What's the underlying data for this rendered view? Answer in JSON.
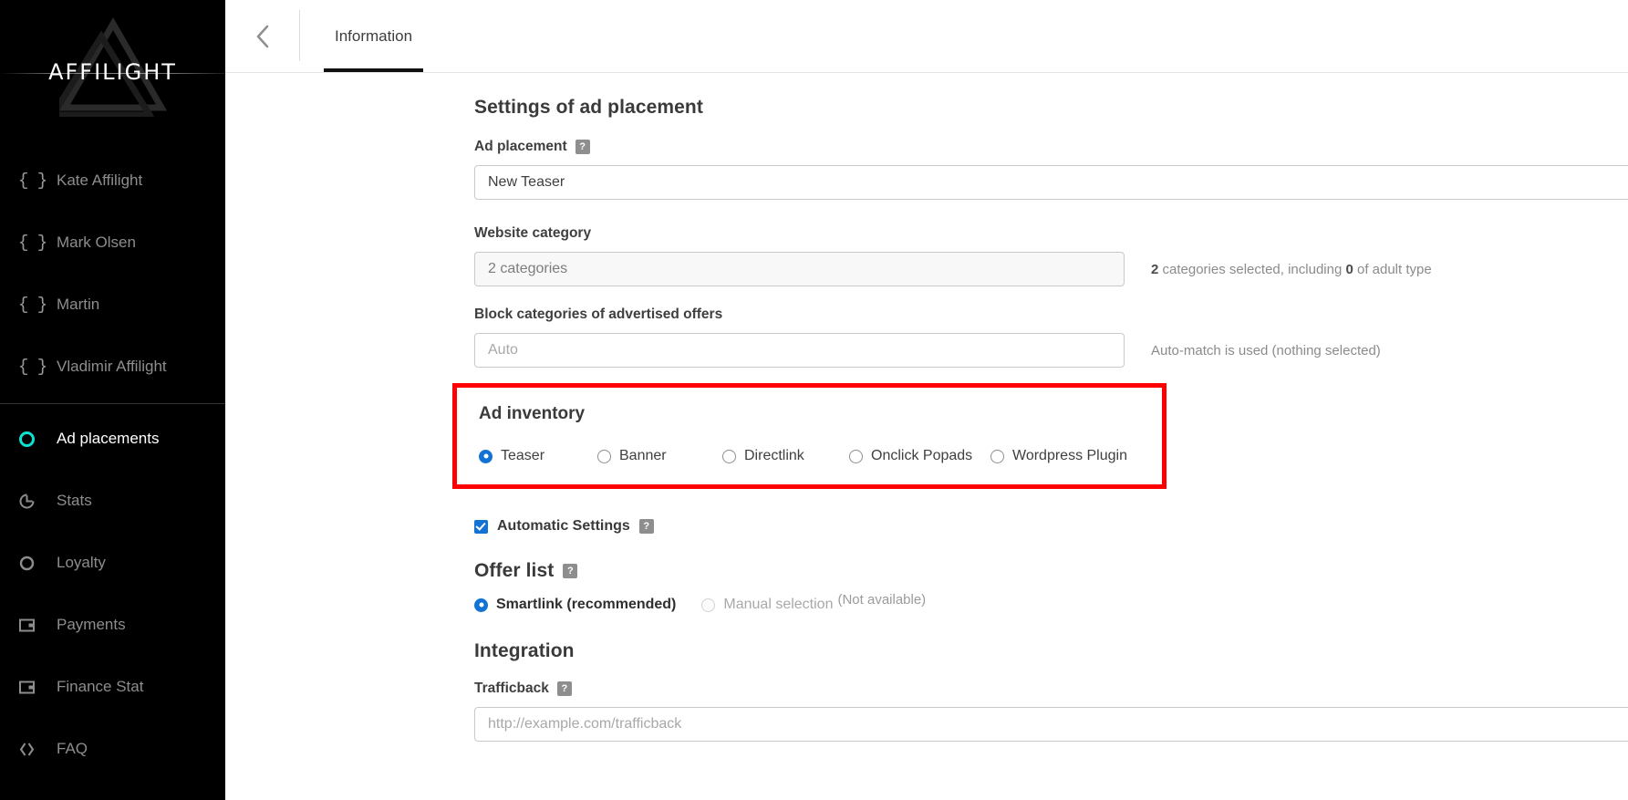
{
  "sidebar": {
    "logo": {
      "text": "AFFILIGHT",
      "icon": "triangle-logo-icon"
    },
    "accounts": [
      {
        "label": "Kate Affilight",
        "icon": "braces-icon"
      },
      {
        "label": "Mark Olsen",
        "icon": "braces-icon"
      },
      {
        "label": "Martin",
        "icon": "braces-icon"
      },
      {
        "label": "Vladimir Affilight",
        "icon": "braces-icon"
      }
    ],
    "nav": [
      {
        "label": "Ad placements",
        "icon": "ring-icon",
        "active": true
      },
      {
        "label": "Stats",
        "icon": "pie-chart-icon",
        "active": false
      },
      {
        "label": "Loyalty",
        "icon": "circle-icon",
        "active": false
      },
      {
        "label": "Payments",
        "icon": "wallet-icon",
        "active": false
      },
      {
        "label": "Finance Stat",
        "icon": "wallet-icon",
        "active": false
      },
      {
        "label": "FAQ",
        "icon": "diamond-brackets-icon",
        "active": false
      }
    ],
    "active_color": "#0ae3d2"
  },
  "topbar": {
    "back_icon": "chevron-left-icon",
    "tabs": [
      {
        "label": "Information",
        "active": true
      }
    ]
  },
  "main": {
    "section_settings_title": "Settings of ad placement",
    "ad_placement": {
      "label": "Ad placement",
      "help": "?",
      "value": "New Teaser"
    },
    "website_category": {
      "label": "Website category",
      "value": "2 categories",
      "hint_count": "2",
      "hint_mid": " categories selected, including ",
      "hint_adult_count": "0",
      "hint_end": " of adult type"
    },
    "block_categories": {
      "label": "Block categories of advertised offers",
      "placeholder": "Auto",
      "value": "",
      "hint": "Auto-match is used (nothing selected)"
    },
    "ad_inventory": {
      "title": "Ad inventory",
      "highlight_color": "#ff0000",
      "options": [
        {
          "label": "Teaser",
          "selected": true
        },
        {
          "label": "Banner",
          "selected": false
        },
        {
          "label": "Directlink",
          "selected": false
        },
        {
          "label": "Onclick Popads",
          "selected": false
        },
        {
          "label": "Wordpress Plugin",
          "selected": false
        }
      ]
    },
    "automatic_settings": {
      "label": "Automatic Settings",
      "help": "?",
      "checked": true
    },
    "offer_list": {
      "title": "Offer list",
      "help": "?",
      "options": [
        {
          "label": "Smartlink (recommended)",
          "selected": true,
          "disabled": false,
          "note": ""
        },
        {
          "label": "Manual selection",
          "selected": false,
          "disabled": true,
          "note": "(Not available)"
        }
      ]
    },
    "integration": {
      "title": "Integration",
      "trafficback": {
        "label": "Trafficback",
        "help": "?",
        "placeholder": "http://example.com/trafficback",
        "value": ""
      }
    }
  }
}
